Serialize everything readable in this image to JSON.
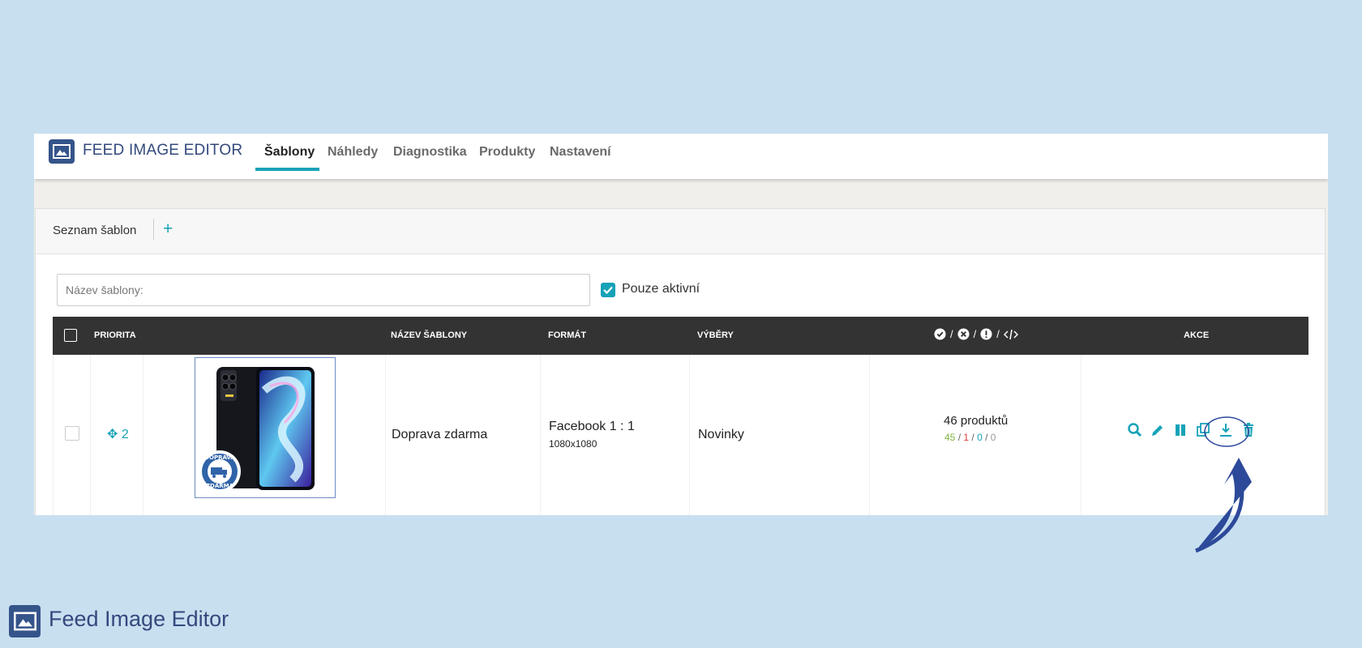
{
  "app": {
    "title": "FEED IMAGE EDITOR"
  },
  "tabs": [
    "Šablony",
    "Náhledy",
    "Diagnostika",
    "Produkty",
    "Nastavení"
  ],
  "panel": {
    "title": "Seznam šablon",
    "add_label": "+"
  },
  "search": {
    "placeholder": "Název šablony:",
    "value": ""
  },
  "filter": {
    "label": "Pouze aktivní",
    "checked": true
  },
  "table": {
    "headers": {
      "priority": "PRIORITA",
      "name": "NÁZEV ŠABLONY",
      "format": "FORMÁT",
      "selections": "VÝBĚRY",
      "actions": "AKCE"
    },
    "stats_header_icons": [
      "check-circle-icon",
      "x-circle-icon",
      "exclamation-circle-icon",
      "code-icon"
    ],
    "rows": [
      {
        "priority": "2",
        "name": "Doprava zdarma",
        "format": "Facebook 1 : 1",
        "format_size": "1080x1080",
        "selection": "Novinky",
        "products": "46 produktů",
        "ok": "45",
        "error": "1",
        "warning": "0",
        "code": "0",
        "badge_text": [
          "DOPRAVA",
          "ZDARMA"
        ]
      }
    ]
  },
  "colors": {
    "accent": "#17a2b8",
    "brand": "#33497d",
    "ok": "#7cb342",
    "error": "#e53935",
    "warning": "#17a2b8",
    "muted": "#999999"
  },
  "footer": {
    "title": "Feed Image Editor"
  }
}
